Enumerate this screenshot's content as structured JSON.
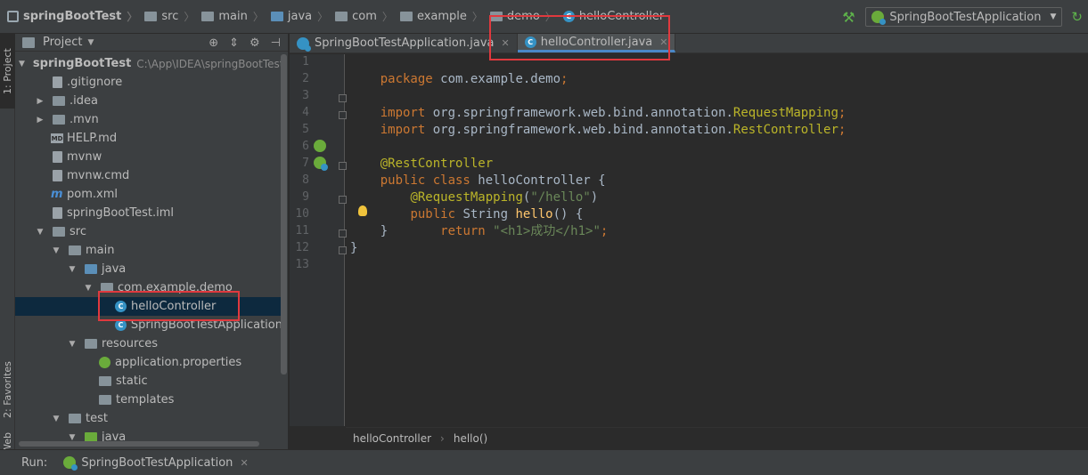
{
  "breadcrumb": [
    "springBootTest",
    "src",
    "main",
    "java",
    "com",
    "example",
    "demo",
    "helloController"
  ],
  "run_config": {
    "name": "SpringBootTestApplication",
    "icon": "spring-boot-icon"
  },
  "left_strip": {
    "project_tab": "1: Project",
    "favorites_tab": "2: Favorites",
    "web_tab": "Web"
  },
  "project": {
    "title": "Project",
    "tree": [
      {
        "label": "springBootTest",
        "extra": "C:\\App\\IDEA\\springBootTest",
        "icon": "project-folder-icon",
        "expanded": true
      },
      {
        "label": ".gitignore",
        "icon": "file-icon"
      },
      {
        "label": ".idea",
        "icon": "folder-icon",
        "expanded": false
      },
      {
        "label": ".mvn",
        "icon": "folder-icon",
        "expanded": false
      },
      {
        "label": "HELP.md",
        "icon": "markdown-icon"
      },
      {
        "label": "mvnw",
        "icon": "file-icon"
      },
      {
        "label": "mvnw.cmd",
        "icon": "file-icon"
      },
      {
        "label": "pom.xml",
        "icon": "maven-icon"
      },
      {
        "label": "springBootTest.iml",
        "icon": "file-icon"
      },
      {
        "label": "src",
        "icon": "folder-icon",
        "expanded": true
      },
      {
        "label": "main",
        "icon": "folder-icon",
        "expanded": true
      },
      {
        "label": "java",
        "icon": "source-folder-icon",
        "expanded": true
      },
      {
        "label": "com.example.demo",
        "icon": "package-icon",
        "expanded": true
      },
      {
        "label": "helloController",
        "icon": "class-icon",
        "selected": true
      },
      {
        "label": "SpringBootTestApplication",
        "icon": "class-icon"
      },
      {
        "label": "resources",
        "icon": "resources-folder-icon",
        "expanded": true
      },
      {
        "label": "application.properties",
        "icon": "spring-properties-icon"
      },
      {
        "label": "static",
        "icon": "folder-icon"
      },
      {
        "label": "templates",
        "icon": "folder-icon"
      },
      {
        "label": "test",
        "icon": "folder-icon",
        "expanded": true
      },
      {
        "label": "java",
        "icon": "test-folder-icon",
        "expanded": true
      }
    ]
  },
  "tabs": [
    {
      "label": "SpringBootTestApplication.java",
      "icon": "spring-class-icon",
      "active": false
    },
    {
      "label": "helloController.java",
      "icon": "class-icon",
      "active": true
    }
  ],
  "editor": {
    "line_numbers": [
      "1",
      "2",
      "3",
      "4",
      "5",
      "6",
      "7",
      "8",
      "9",
      "10",
      "11",
      "12",
      "13"
    ],
    "lines": [
      "package com.example.demo;",
      "",
      "import org.springframework.web.bind.annotation.RequestMapping;",
      "import org.springframework.web.bind.annotation.RestController;",
      "",
      "@RestController",
      "public class helloController {",
      "    @RequestMapping(\"/hello\")",
      "    public String hello() {",
      "        return \"<h1>成功</h1>\";",
      "    }",
      "}",
      ""
    ],
    "breadcrumb": [
      "helloController",
      "hello()"
    ]
  },
  "run_bar": {
    "label": "Run:",
    "tab": "SpringBootTestApplication"
  },
  "colors": {
    "keyword": "#cc7832",
    "annotation": "#bbb529",
    "string": "#6a8759",
    "method": "#ffc66d",
    "highlight_box": "#e0393e"
  }
}
